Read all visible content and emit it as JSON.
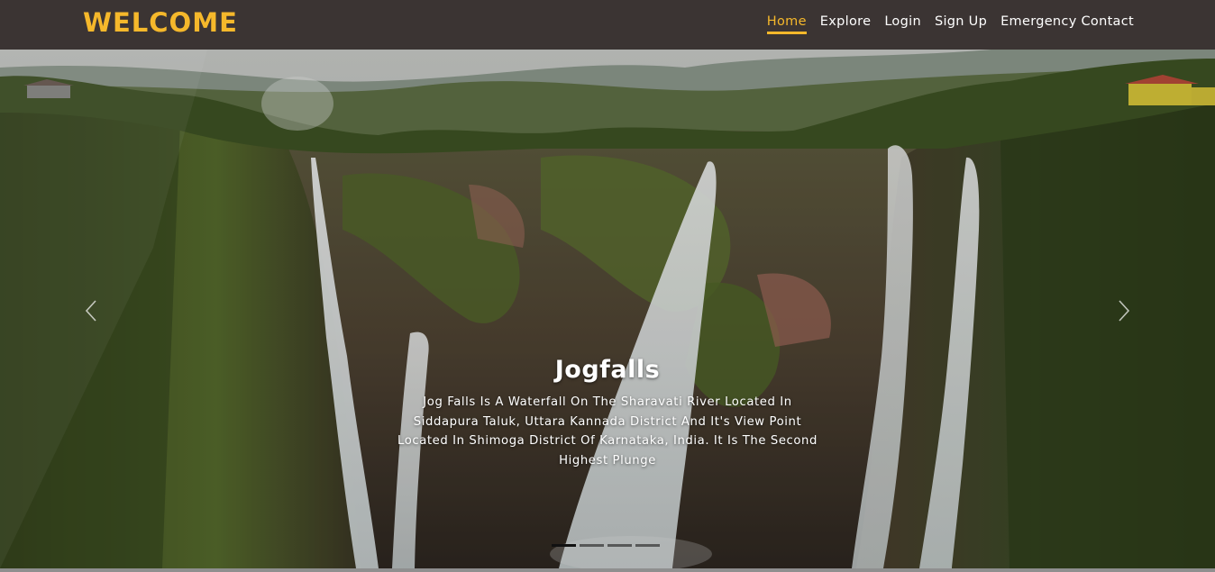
{
  "brand": {
    "title": "WELCOME"
  },
  "nav": {
    "items": [
      {
        "label": "Home",
        "active": true
      },
      {
        "label": "Explore",
        "active": false
      },
      {
        "label": "Login",
        "active": false
      },
      {
        "label": "Sign Up",
        "active": false
      },
      {
        "label": "Emergency Contact",
        "active": false
      }
    ]
  },
  "carousel": {
    "slide": {
      "title": "Jogfalls",
      "description": "Jog Falls Is A Waterfall On The Sharavati River Located In Siddapura Taluk, Uttara Kannada District And It's View Point Located In Shimoga District Of Karnataka, India. It Is The Second Highest Plunge",
      "image": "waterfall-cliff-photo"
    },
    "indicator_count": 4,
    "active_indicator": 1,
    "prev_icon": "chevron-left-icon",
    "next_icon": "chevron-right-icon"
  },
  "colors": {
    "navbar_bg": "#3b3433",
    "accent": "#f5b82b",
    "text": "#ffffff"
  }
}
